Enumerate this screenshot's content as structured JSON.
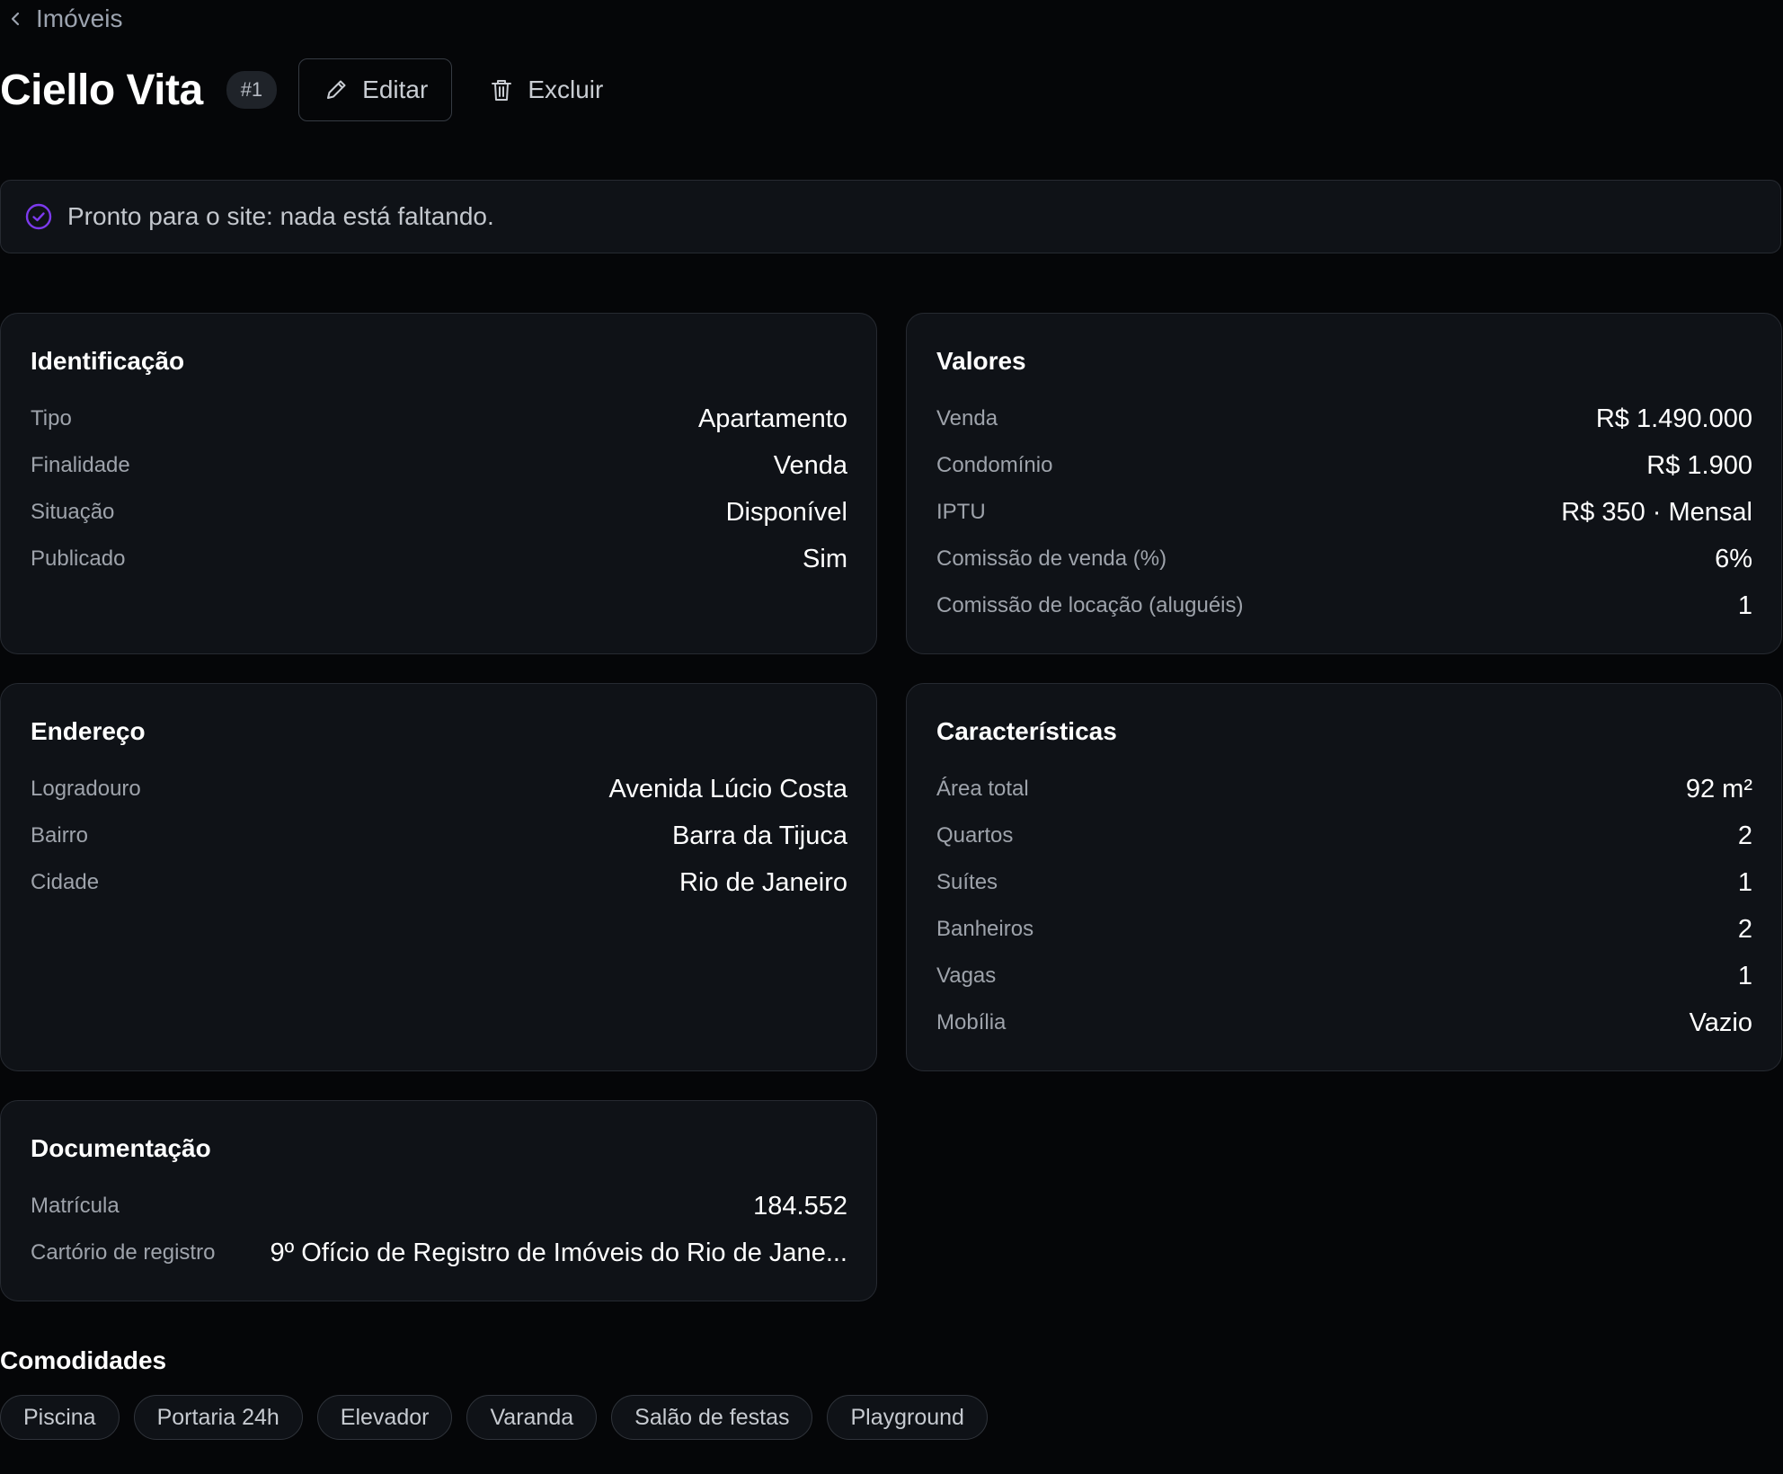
{
  "breadcrumb": {
    "back_label": "Imóveis"
  },
  "header": {
    "title": "Ciello Vita",
    "id_badge": "#1",
    "edit_label": "Editar",
    "delete_label": "Excluir"
  },
  "status": {
    "text": "Pronto para o site: nada está faltando.",
    "accent_color": "#7c3aed"
  },
  "identificacao": {
    "title": "Identificação",
    "rows": [
      {
        "label": "Tipo",
        "value": "Apartamento"
      },
      {
        "label": "Finalidade",
        "value": "Venda"
      },
      {
        "label": "Situação",
        "value": "Disponível"
      },
      {
        "label": "Publicado",
        "value": "Sim"
      }
    ]
  },
  "valores": {
    "title": "Valores",
    "rows": [
      {
        "label": "Venda",
        "value": "R$ 1.490.000"
      },
      {
        "label": "Condomínio",
        "value": "R$ 1.900"
      },
      {
        "label": "IPTU",
        "value": "R$ 350 · Mensal"
      },
      {
        "label": "Comissão de venda (%)",
        "value": "6%"
      },
      {
        "label": "Comissão de locação (aluguéis)",
        "value": "1"
      }
    ]
  },
  "endereco": {
    "title": "Endereço",
    "rows": [
      {
        "label": "Logradouro",
        "value": "Avenida Lúcio Costa"
      },
      {
        "label": "Bairro",
        "value": "Barra da Tijuca"
      },
      {
        "label": "Cidade",
        "value": "Rio de Janeiro"
      }
    ]
  },
  "caracteristicas": {
    "title": "Características",
    "rows": [
      {
        "label": "Área total",
        "value": "92 m²"
      },
      {
        "label": "Quartos",
        "value": "2"
      },
      {
        "label": "Suítes",
        "value": "1"
      },
      {
        "label": "Banheiros",
        "value": "2"
      },
      {
        "label": "Vagas",
        "value": "1"
      },
      {
        "label": "Mobília",
        "value": "Vazio"
      }
    ]
  },
  "documentacao": {
    "title": "Documentação",
    "rows": [
      {
        "label": "Matrícula",
        "value": "184.552"
      },
      {
        "label": "Cartório de registro",
        "value": "9º Ofício de Registro de Imóveis do Rio de Jane..."
      }
    ]
  },
  "comodidades": {
    "title": "Comodidades",
    "items": [
      "Piscina",
      "Portaria 24h",
      "Elevador",
      "Varanda",
      "Salão de festas",
      "Playground"
    ]
  },
  "icons": {
    "back": "chevron-left-icon",
    "edit": "pencil-icon",
    "delete": "trash-icon",
    "status": "check-circle-icon"
  }
}
